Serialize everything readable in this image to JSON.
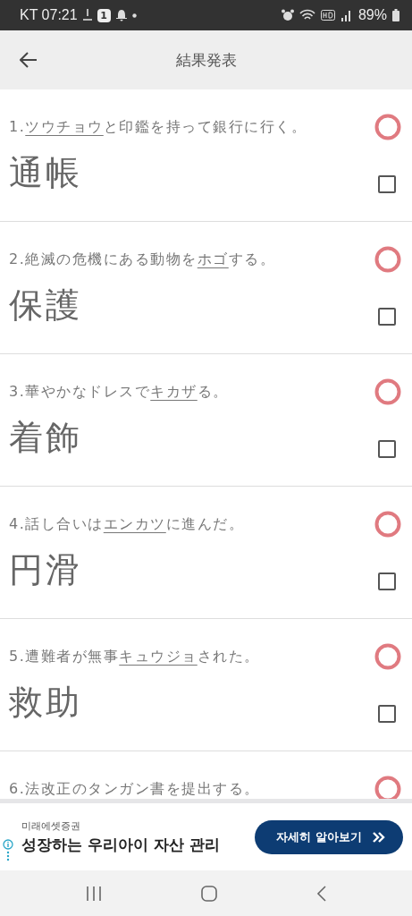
{
  "status_bar": {
    "carrier_time": "KT 07:21",
    "notification_count": "1",
    "battery": "89%"
  },
  "app_bar": {
    "title": "結果発表"
  },
  "questions": [
    {
      "number": "1.",
      "underlined": "ツウチョウ",
      "after": "と印鑑を持って銀行に行く。",
      "answer": "通帳",
      "checked": false
    },
    {
      "number": "2.",
      "before": "絶滅の危機にある動物を",
      "underlined": "ホゴ",
      "after": "する。",
      "answer": "保護",
      "checked": false
    },
    {
      "number": "3.",
      "before": "華やかなドレスで",
      "underlined": "キカザ",
      "after": "る。",
      "answer": "着飾",
      "checked": false
    },
    {
      "number": "4.",
      "before": "話し合いは",
      "underlined": "エンカツ",
      "after": "に進んだ。",
      "answer": "円滑",
      "checked": false
    },
    {
      "number": "5.",
      "before": "遭難者が無事",
      "underlined": "キュウジョ",
      "after": "された。",
      "answer": "救助",
      "checked": false
    },
    {
      "number": "6.",
      "before": "法改正のタンガン書を提出する。"
    }
  ],
  "ad": {
    "advertiser": "미래에셋증권",
    "headline": "성장하는 우리아이 자산 관리",
    "button": "자세히 알아보기"
  }
}
